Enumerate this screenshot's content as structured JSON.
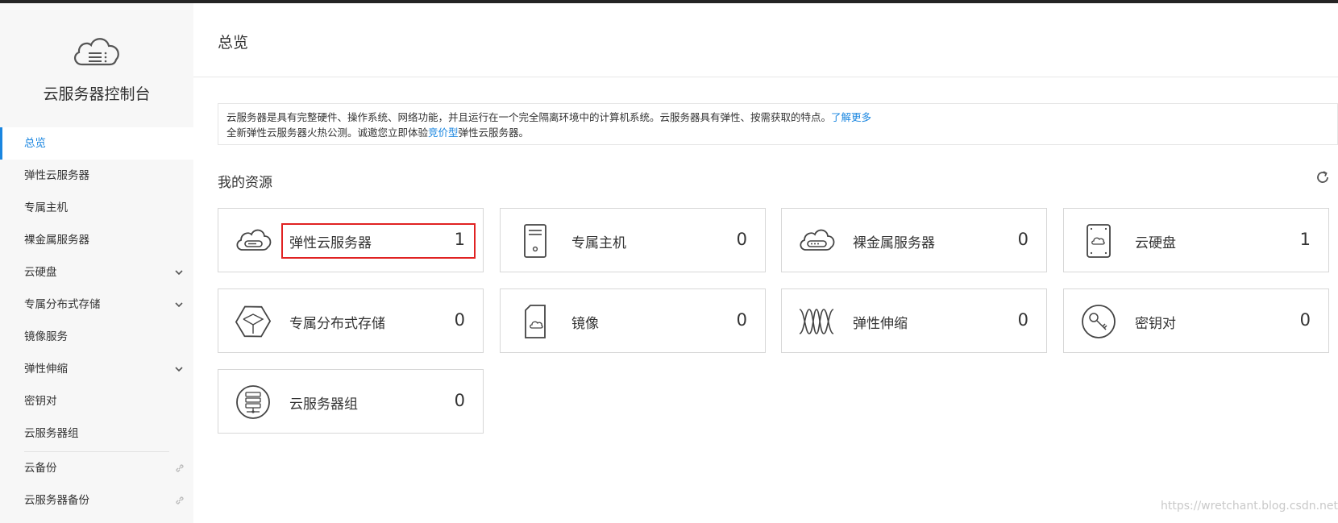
{
  "app": {
    "title": "云服务器控制台",
    "logo_icon": "cloud-server-icon"
  },
  "sidebar": {
    "items": [
      {
        "label": "总览",
        "active": true
      },
      {
        "label": "弹性云服务器"
      },
      {
        "label": "专属主机"
      },
      {
        "label": "裸金属服务器"
      },
      {
        "label": "云硬盘",
        "expandable": true
      },
      {
        "label": "专属分布式存储",
        "expandable": true
      },
      {
        "label": "镜像服务"
      },
      {
        "label": "弹性伸缩",
        "expandable": true
      },
      {
        "label": "密钥对"
      },
      {
        "label": "云服务器组"
      },
      {
        "label": "云备份",
        "external": true
      },
      {
        "label": "云服务器备份",
        "external": true
      }
    ]
  },
  "header": {
    "title": "总览"
  },
  "notice": {
    "line1": "云服务器是具有完整硬件、操作系统、网络功能，并且运行在一个完全隔离环境中的计算机系统。云服务器具有弹性、按需获取的特点。",
    "line1_link": "了解更多",
    "line2_pre": "全新弹性云服务器火热公测。诚邀您立即体验",
    "line2_link": "竞价型",
    "line2_post": "弹性云服务器。"
  },
  "resources": {
    "title": "我的资源",
    "refresh_icon": "refresh-icon",
    "cards": [
      {
        "name": "弹性云服务器",
        "count": "1",
        "icon": "ecs-cloud-icon",
        "highlighted": true
      },
      {
        "name": "专属主机",
        "count": "0",
        "icon": "dedicated-host-icon"
      },
      {
        "name": "裸金属服务器",
        "count": "0",
        "icon": "bare-metal-icon"
      },
      {
        "name": "云硬盘",
        "count": "1",
        "icon": "cloud-disk-icon"
      },
      {
        "name": "专属分布式存储",
        "count": "0",
        "icon": "distributed-storage-icon"
      },
      {
        "name": "镜像",
        "count": "0",
        "icon": "image-icon"
      },
      {
        "name": "弹性伸缩",
        "count": "0",
        "icon": "auto-scaling-icon"
      },
      {
        "name": "密钥对",
        "count": "0",
        "icon": "key-pair-icon"
      },
      {
        "name": "云服务器组",
        "count": "0",
        "icon": "server-group-icon"
      }
    ]
  },
  "colors": {
    "accent": "#1a86e0",
    "highlight": "#e02222",
    "sidebar_bg": "#f7f7f7"
  },
  "watermark": "https://wretchant.blog.csdn.net"
}
